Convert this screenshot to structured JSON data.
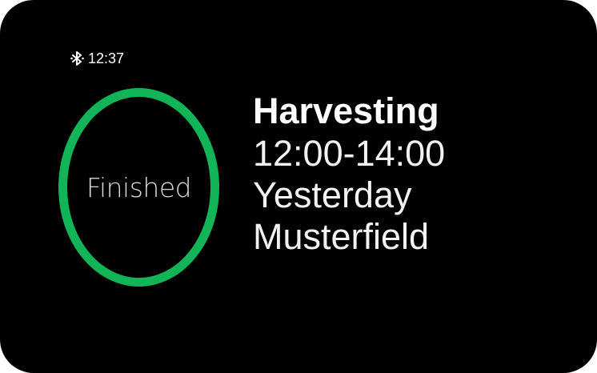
{
  "status": {
    "bluetooth_icon": "bluetooth-icon",
    "time": "12:37"
  },
  "progress": {
    "state_label": "Finished",
    "ring_color": "#11b558"
  },
  "task": {
    "title": "Harvesting",
    "time_range": "12:00-14:00",
    "day": "Yesterday",
    "field": "Musterfield"
  }
}
